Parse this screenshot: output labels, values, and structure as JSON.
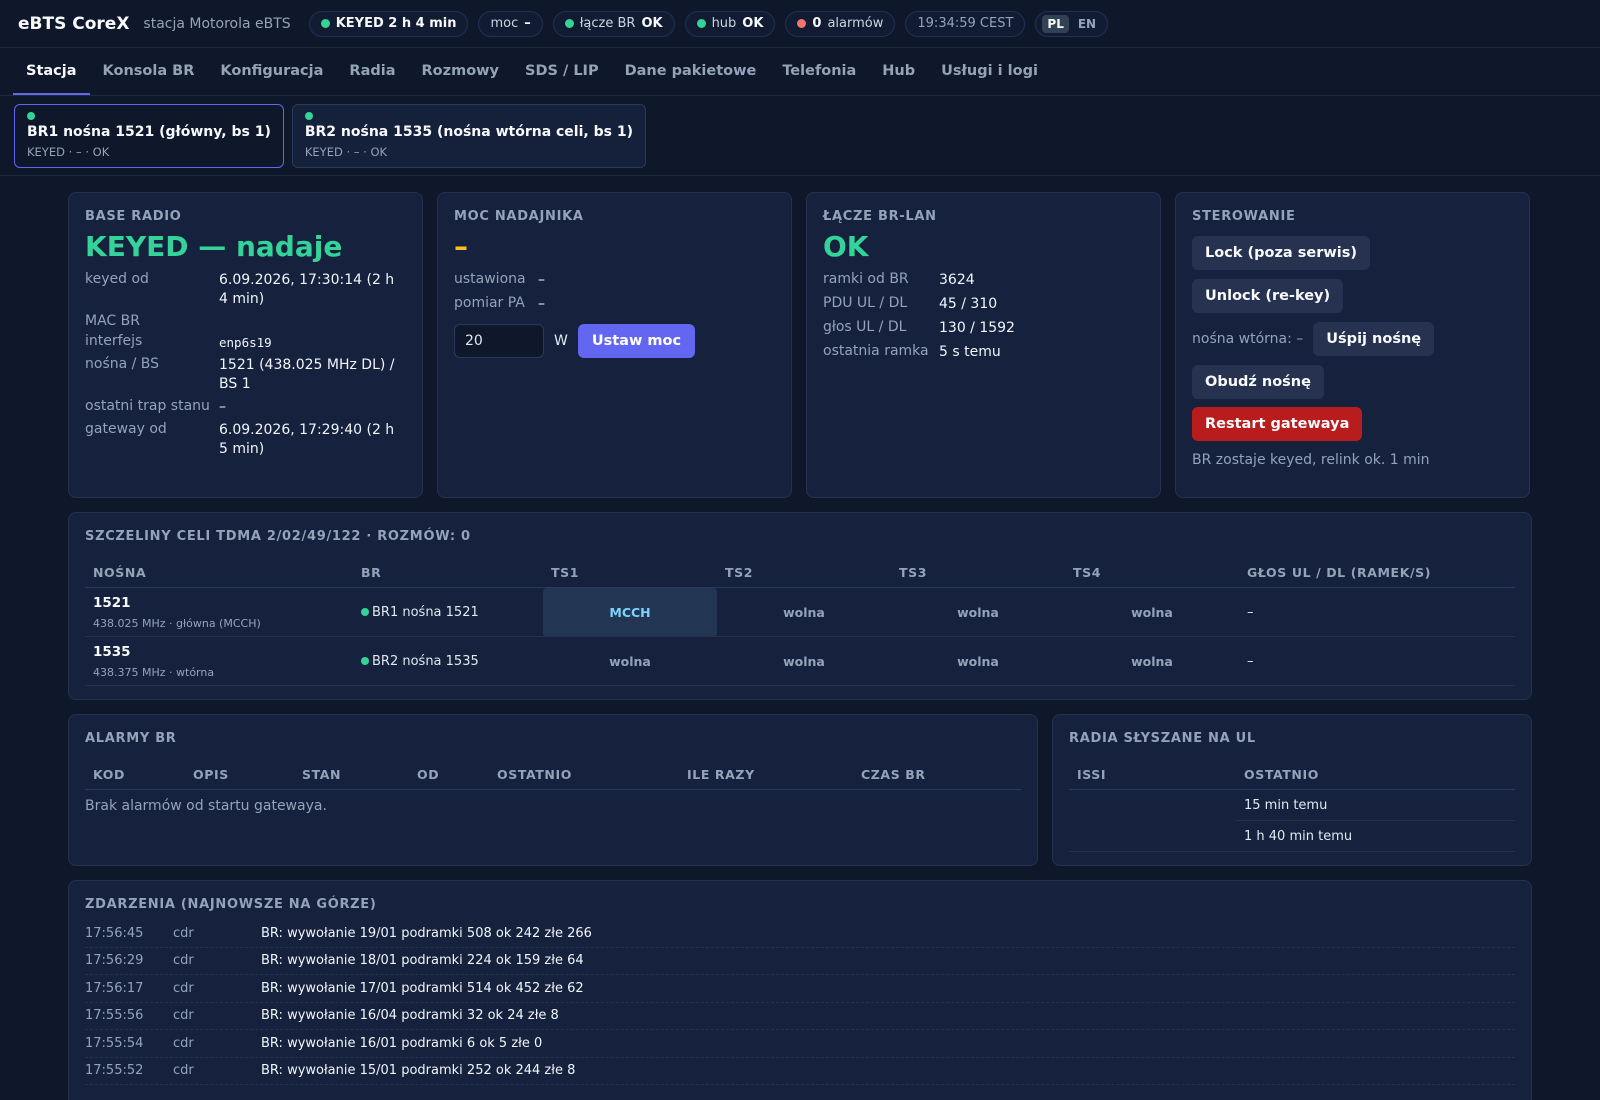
{
  "header": {
    "brand": "eBTS CoreX",
    "station": "stacja Motorola eBTS",
    "pills": {
      "keyed": "KEYED 2 h 4 min",
      "power_label": "moc",
      "power_value": "–",
      "link_label": "łącze BR",
      "link_value": "OK",
      "hub_label": "hub",
      "hub_value": "OK",
      "alarms_count": "0",
      "alarms_label": "alarmów",
      "clock": "19:34:59 CEST"
    },
    "lang": {
      "pl": "PL",
      "en": "EN"
    }
  },
  "tabs": [
    {
      "label": "Stacja"
    },
    {
      "label": "Konsola BR"
    },
    {
      "label": "Konfiguracja"
    },
    {
      "label": "Radia"
    },
    {
      "label": "Rozmowy"
    },
    {
      "label": "SDS / LIP"
    },
    {
      "label": "Dane pakietowe"
    },
    {
      "label": "Telefonia"
    },
    {
      "label": "Hub"
    },
    {
      "label": "Usługi i logi"
    }
  ],
  "carriers": [
    {
      "title": "BR1 nośna 1521 (główny, bs 1)",
      "sub": "KEYED · – · OK"
    },
    {
      "title": "BR2 nośna 1535 (nośna wtórna celi, bs 1)",
      "sub": "KEYED · – · OK"
    }
  ],
  "base_radio": {
    "title": "BASE RADIO",
    "status": "KEYED — nadaje",
    "rows": [
      {
        "k": "keyed od",
        "v": "6.09.2026, 17:30:14 (2 h 4 min)"
      },
      {
        "k": "MAC BR",
        "v": ""
      },
      {
        "k": "interfejs",
        "v": "enp6s19"
      },
      {
        "k": "nośna / BS",
        "v": "1521 (438.025 MHz DL) / BS 1"
      },
      {
        "k": "ostatni trap stanu",
        "v": "–"
      },
      {
        "k": "gateway od",
        "v": "6.09.2026, 17:29:40 (2 h 5 min)"
      }
    ]
  },
  "power": {
    "title": "MOC NADAJNIKA",
    "status": "–",
    "rows": [
      {
        "k": "ustawiona",
        "v": "–"
      },
      {
        "k": "pomiar PA",
        "v": "–"
      }
    ],
    "input_value": "20",
    "unit": "W",
    "set_button": "Ustaw moc"
  },
  "link": {
    "title": "ŁĄCZE BR-LAN",
    "status": "OK",
    "rows": [
      {
        "k": "ramki od BR",
        "v": "3624"
      },
      {
        "k": "PDU UL / DL",
        "v": "45 / 310"
      },
      {
        "k": "głos UL / DL",
        "v": "130 / 1592"
      },
      {
        "k": "ostatnia ramka",
        "v": "5 s temu"
      }
    ]
  },
  "control": {
    "title": "STEROWANIE",
    "lock": "Lock (poza serwis)",
    "unlock": "Unlock (re-key)",
    "secondary_label": "nośna wtórna: –",
    "sleep": "Uśpij nośnę",
    "wake": "Obudź nośnę",
    "restart": "Restart gatewaya",
    "note": "BR zostaje keyed, relink ok. 1 min"
  },
  "slots": {
    "title": "SZCZELINY CELI TDMA 2/02/49/122 · ROZMÓW: 0",
    "headers": [
      "NOŚNA",
      "BR",
      "TS1",
      "TS2",
      "TS3",
      "TS4",
      "GŁOS UL / DL (RAMEK/S)"
    ],
    "rows": [
      {
        "carrier": "1521",
        "freq": "438.025 MHz · główna (MCCH)",
        "br": "BR1 nośna 1521",
        "ts": [
          "MCCH",
          "wolna",
          "wolna",
          "wolna"
        ],
        "voice": "–"
      },
      {
        "carrier": "1535",
        "freq": "438.375 MHz · wtórna",
        "br": "BR2 nośna 1535",
        "ts": [
          "wolna",
          "wolna",
          "wolna",
          "wolna"
        ],
        "voice": "–"
      }
    ]
  },
  "alarms": {
    "title": "ALARMY BR",
    "headers": [
      "KOD",
      "OPIS",
      "STAN",
      "OD",
      "OSTATNIO",
      "ILE RAZY",
      "CZAS BR"
    ],
    "empty": "Brak alarmów od startu gatewaya."
  },
  "heard": {
    "title": "RADIA SŁYSZANE NA UL",
    "headers": [
      "ISSI",
      "OSTATNIO"
    ],
    "rows": [
      {
        "issi": "",
        "last": "15 min temu"
      },
      {
        "issi": "",
        "last": "1 h 40 min temu"
      }
    ]
  },
  "events": {
    "title": "ZDARZENIA (NAJNOWSZE NA GÓRZE)",
    "rows": [
      {
        "time": "17:56:45",
        "type": "cdr",
        "msg": "BR: wywołanie 19/01 podramki 508 ok 242 złe 266"
      },
      {
        "time": "17:56:29",
        "type": "cdr",
        "msg": "BR: wywołanie 18/01 podramki 224 ok 159 złe 64"
      },
      {
        "time": "17:56:17",
        "type": "cdr",
        "msg": "BR: wywołanie 17/01 podramki 514 ok 452 złe 62"
      },
      {
        "time": "17:55:56",
        "type": "cdr",
        "msg": "BR: wywołanie 16/04 podramki 32 ok 24 złe 8"
      },
      {
        "time": "17:55:54",
        "type": "cdr",
        "msg": "BR: wywołanie 16/01 podramki 6 ok 5 złe 0"
      },
      {
        "time": "17:55:52",
        "type": "cdr",
        "msg": "BR: wywołanie 15/01 podramki 252 ok 244 złe 8"
      }
    ]
  },
  "colors": {
    "accent": "#6366f1",
    "ok": "#34d399",
    "warn": "#fbbf24",
    "danger": "#b91c1c",
    "background": "#0f172a"
  }
}
